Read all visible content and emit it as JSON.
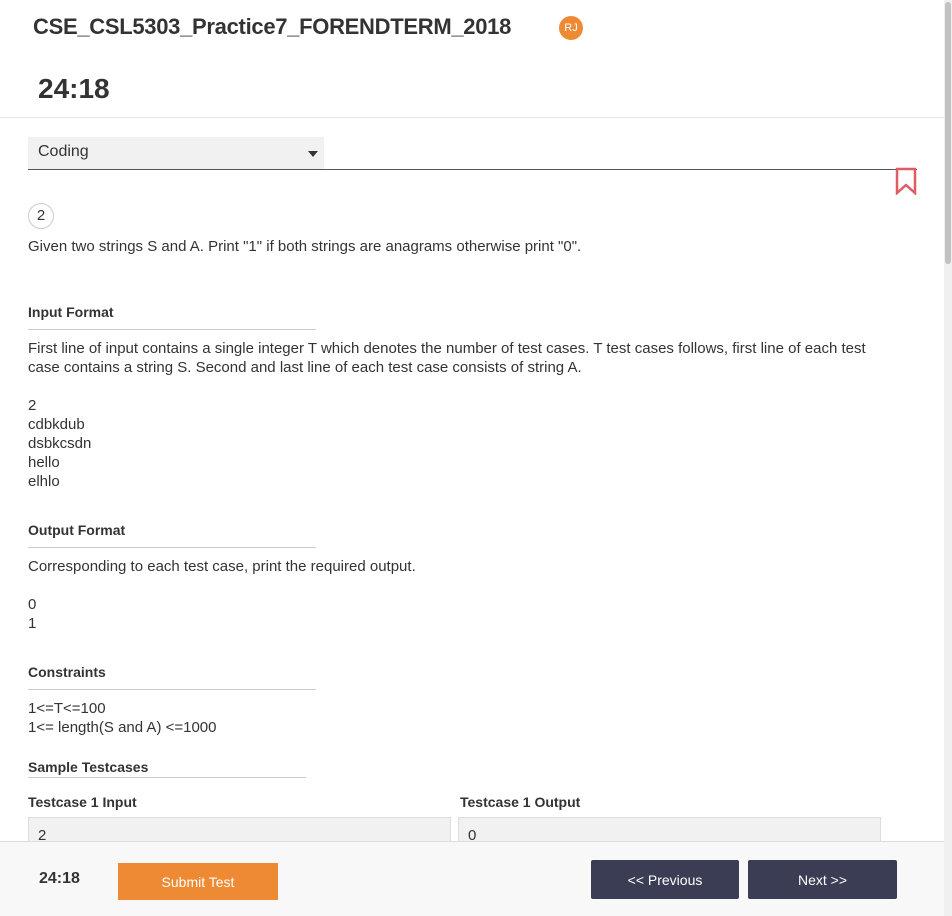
{
  "header": {
    "title": "CSE_CSL5303_Practice7_FORENDTERM_2018",
    "avatar_initials": "RJ",
    "timer": "24:18"
  },
  "section_select": {
    "value": "Coding"
  },
  "question": {
    "number": "2",
    "text": "Given two strings S and A. Print \"1\" if both strings are anagrams otherwise print \"0\".",
    "input_format": {
      "heading": "Input Format",
      "text": "First line of input contains a single integer T which denotes the number of test cases. T test cases follows, first line of each test case contains a string S. Second and last line of each test case consists of string A.",
      "example": [
        "2",
        "cdbkdub",
        "dsbkcsdn",
        "hello",
        "elhlo"
      ]
    },
    "output_format": {
      "heading": "Output Format",
      "text": "Corresponding to each test case, print the required output.",
      "example": [
        "0",
        "1"
      ]
    },
    "constraints": {
      "heading": "Constraints",
      "lines": [
        "1<=T<=100",
        "1<= length(S and A) <=1000"
      ]
    },
    "sample_testcases": {
      "heading": "Sample Testcases",
      "input_label": "Testcase 1 Input",
      "input_value": "2",
      "output_label": "Testcase 1 Output",
      "output_value": "0"
    }
  },
  "footer": {
    "timer": "24:18",
    "submit_label": "Submit Test",
    "prev_label": "<< Previous",
    "next_label": "Next >>"
  },
  "colors": {
    "accent_orange": "#ee8a33",
    "nav_button": "#3a3d54",
    "bookmark": "#e05b62"
  },
  "icons": {
    "bookmark": "bookmark-outline-icon",
    "dropdown": "caret-down-icon"
  }
}
